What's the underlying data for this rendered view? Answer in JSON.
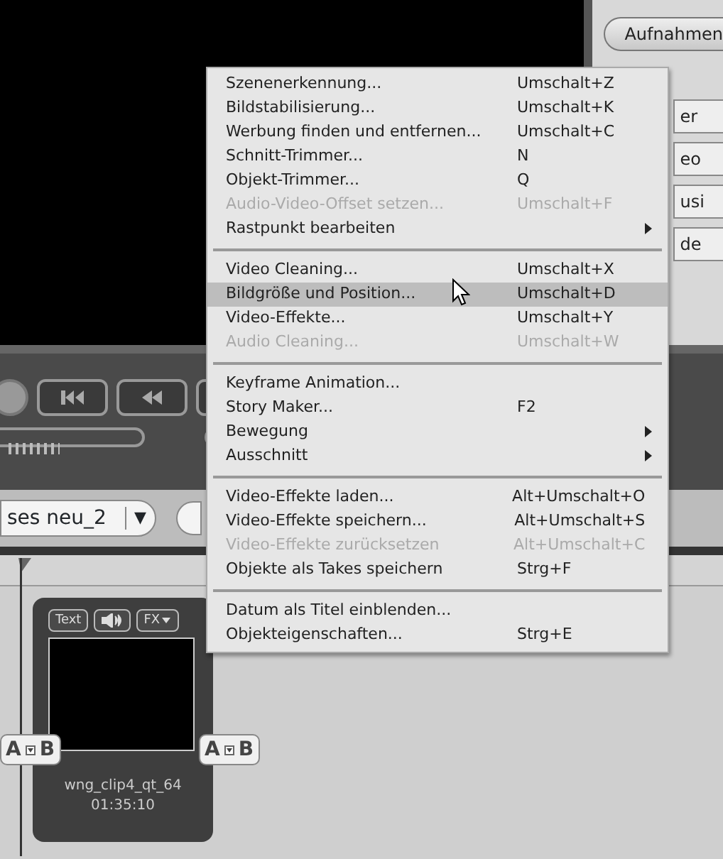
{
  "right_panel": {
    "buttons": [
      {
        "label": "Aufnahmen"
      }
    ],
    "tabs": [
      {
        "label": "er"
      },
      {
        "label": "eo"
      },
      {
        "label": "usi"
      },
      {
        "label": "de"
      }
    ]
  },
  "toolbar": {
    "dropdown": {
      "value": "ses neu_2",
      "arrow": "▼"
    }
  },
  "clip": {
    "buttons": [
      {
        "kind": "text",
        "label": "Text"
      },
      {
        "kind": "audio"
      },
      {
        "kind": "fx",
        "label": "FX"
      }
    ],
    "name": "wng_clip4_qt_64",
    "time": "01:35:10",
    "transitions": [
      {
        "left": "A",
        "right": "B"
      },
      {
        "left": "A",
        "right": "B"
      }
    ]
  },
  "context_menu": {
    "sections": [
      {
        "items": [
          {
            "label": "Szenenerkennung...",
            "shortcut": "Umschalt+Z",
            "disabled": false,
            "submenu": false,
            "selected": false
          },
          {
            "label": "Bildstabilisierung...",
            "shortcut": "Umschalt+K",
            "disabled": false,
            "submenu": false,
            "selected": false
          },
          {
            "label": "Werbung finden und entfernen...",
            "shortcut": "Umschalt+C",
            "disabled": false,
            "submenu": false,
            "selected": false
          },
          {
            "label": "Schnitt-Trimmer...",
            "shortcut": "N",
            "disabled": false,
            "submenu": false,
            "selected": false
          },
          {
            "label": "Objekt-Trimmer...",
            "shortcut": "Q",
            "disabled": false,
            "submenu": false,
            "selected": false
          },
          {
            "label": "Audio-Video-Offset setzen...",
            "shortcut": "Umschalt+F",
            "disabled": true,
            "submenu": false,
            "selected": false
          },
          {
            "label": "Rastpunkt bearbeiten",
            "disabled": false,
            "submenu": true,
            "selected": false
          }
        ]
      },
      {
        "items": [
          {
            "label": "Video Cleaning...",
            "shortcut": "Umschalt+X",
            "disabled": false,
            "submenu": false,
            "selected": false
          },
          {
            "label": "Bildgröße und Position...",
            "shortcut": "Umschalt+D",
            "disabled": false,
            "submenu": false,
            "selected": true
          },
          {
            "label": "Video-Effekte...",
            "shortcut": "Umschalt+Y",
            "disabled": false,
            "submenu": false,
            "selected": false
          },
          {
            "label": "Audio Cleaning...",
            "shortcut": "Umschalt+W",
            "disabled": true,
            "submenu": false,
            "selected": false
          }
        ]
      },
      {
        "items": [
          {
            "label": "Keyframe Animation...",
            "disabled": false,
            "submenu": false,
            "selected": false
          },
          {
            "label": "Story Maker...",
            "shortcut": "F2",
            "disabled": false,
            "submenu": false,
            "selected": false
          },
          {
            "label": "Bewegung",
            "disabled": false,
            "submenu": true,
            "selected": false
          },
          {
            "label": "Ausschnitt",
            "disabled": false,
            "submenu": true,
            "selected": false
          }
        ]
      },
      {
        "items": [
          {
            "label": "Video-Effekte laden...",
            "shortcut": "Alt+Umschalt+O",
            "disabled": false,
            "submenu": false,
            "selected": false
          },
          {
            "label": "Video-Effekte speichern...",
            "shortcut": "Alt+Umschalt+S",
            "disabled": false,
            "submenu": false,
            "selected": false
          },
          {
            "label": "Video-Effekte zurücksetzen",
            "shortcut": "Alt+Umschalt+C",
            "disabled": true,
            "submenu": false,
            "selected": false
          },
          {
            "label": "Objekte als Takes speichern",
            "shortcut": "Strg+F",
            "disabled": false,
            "submenu": false,
            "selected": false
          }
        ]
      },
      {
        "items": [
          {
            "label": "Datum als Titel einblenden...",
            "disabled": false,
            "submenu": false,
            "selected": false
          },
          {
            "label": "Objekteigenschaften...",
            "shortcut": "Strg+E",
            "disabled": false,
            "submenu": false,
            "selected": false
          }
        ]
      }
    ]
  }
}
